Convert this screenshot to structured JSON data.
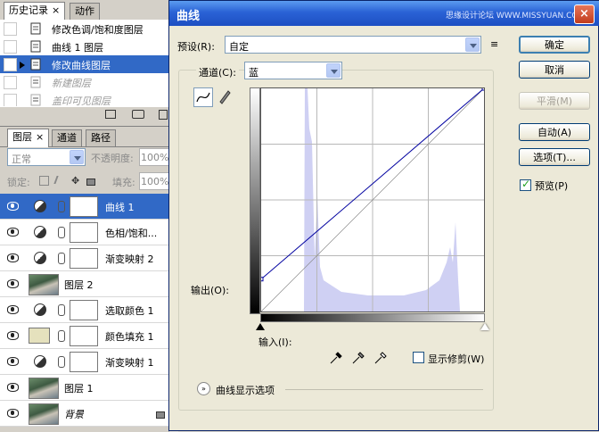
{
  "history": {
    "tabs": [
      {
        "label": "历史记录",
        "close": "×"
      },
      {
        "label": "动作"
      }
    ],
    "items": [
      {
        "label": "修改色调/饱和度图层",
        "state": "normal"
      },
      {
        "label": "曲线 1 图层",
        "state": "normal"
      },
      {
        "label": "修改曲线图层",
        "state": "selected"
      },
      {
        "label": "新建图层",
        "state": "dimmed"
      },
      {
        "label": "盖印可见图层",
        "state": "dimmed"
      }
    ]
  },
  "layers": {
    "tabs": [
      {
        "label": "图层",
        "close": "×"
      },
      {
        "label": "通道"
      },
      {
        "label": "路径"
      }
    ],
    "blend_mode": "正常",
    "opacity_label": "不透明度:",
    "opacity_value": "100%",
    "lock_label": "锁定:",
    "fill_label": "填充:",
    "fill_value": "100%",
    "items": [
      {
        "name": "曲线 1",
        "type": "adjustment",
        "selected": true
      },
      {
        "name": "色相/饱和...",
        "type": "adjustment"
      },
      {
        "name": "渐变映射 2",
        "type": "adjustment"
      },
      {
        "name": "图层 2",
        "type": "image"
      },
      {
        "name": "选取颜色 1",
        "type": "adjustment"
      },
      {
        "name": "颜色填充 1",
        "type": "fill"
      },
      {
        "name": "渐变映射 1",
        "type": "adjustment"
      },
      {
        "name": "图层 1",
        "type": "image"
      },
      {
        "name": "背景",
        "type": "background"
      }
    ]
  },
  "dialog": {
    "title": "曲线",
    "watermark": "思缘设计论坛 WWW.MISSYUAN.COM",
    "close": "×",
    "preset_label": "预设(R):",
    "preset_value": "自定",
    "channel_label": "通道(C):",
    "channel_value": "蓝",
    "output_label": "输出(O):",
    "input_label": "输入(I):",
    "show_clipping_label": "显示修剪(W)",
    "show_clipping": false,
    "curve_display_options": "曲线显示选项",
    "buttons": {
      "ok": "确定",
      "cancel": "取消",
      "smooth": "平滑(M)",
      "auto": "自动(A)",
      "options": "选项(T)..."
    },
    "preview_label": "预览(P)",
    "preview": true,
    "histogram_color": "#cfd0f3",
    "curve_color": "#0000a0",
    "curve_points": [
      [
        0,
        37
      ],
      [
        255,
        255
      ]
    ]
  }
}
